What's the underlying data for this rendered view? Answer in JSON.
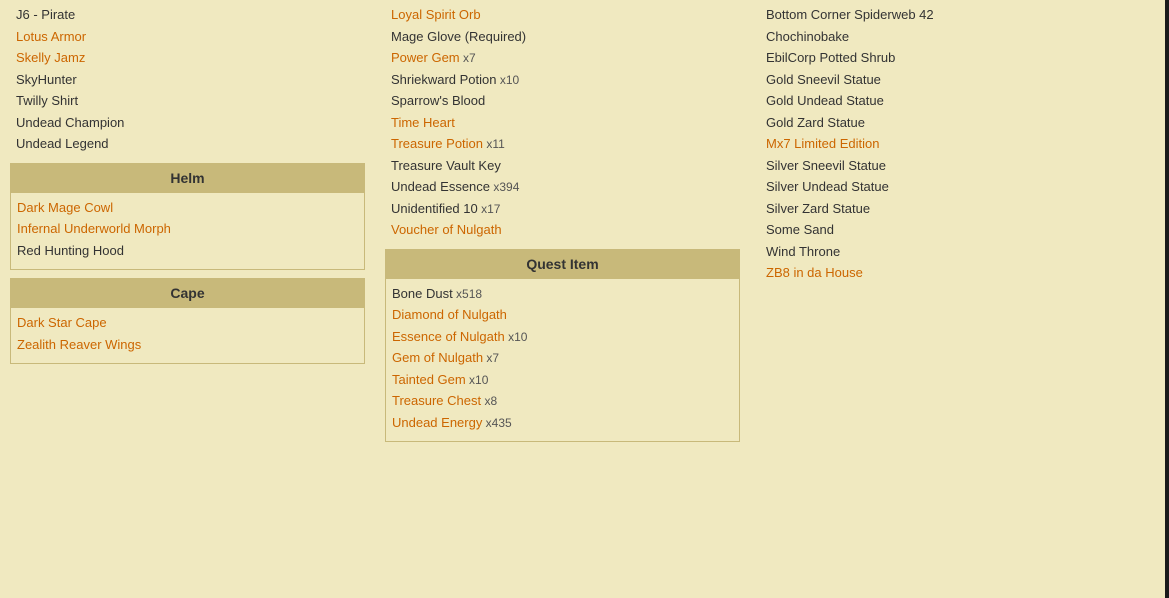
{
  "left": {
    "misc_items": [
      {
        "label": "J6 - Pirate",
        "orange": false
      },
      {
        "label": "Lotus Armor",
        "orange": true
      },
      {
        "label": "Skelly Jamz",
        "orange": true
      },
      {
        "label": "SkyHunter",
        "orange": false
      },
      {
        "label": "Twilly Shirt",
        "orange": false
      },
      {
        "label": "Undead Champion",
        "orange": false
      },
      {
        "label": "Undead Legend",
        "orange": false
      }
    ],
    "helm_header": "Helm",
    "helm_items": [
      {
        "label": "Dark Mage Cowl",
        "orange": true
      },
      {
        "label": "Infernal Underworld Morph",
        "orange": true
      },
      {
        "label": "Red Hunting Hood",
        "orange": false
      }
    ],
    "cape_header": "Cape",
    "cape_items": [
      {
        "label": "Dark Star Cape",
        "orange": true
      },
      {
        "label": "Zealith Reaver Wings",
        "orange": true
      }
    ]
  },
  "middle": {
    "items": [
      {
        "label": "Loyal Spirit Orb",
        "orange": true,
        "count": ""
      },
      {
        "label": "Mage Glove (Required)",
        "orange": false,
        "count": ""
      },
      {
        "label": "Power Gem",
        "orange": true,
        "count": "x7"
      },
      {
        "label": "Shriekward Potion",
        "orange": false,
        "count": "x10"
      },
      {
        "label": "Sparrow's Blood",
        "orange": false,
        "count": ""
      },
      {
        "label": "Time Heart",
        "orange": true,
        "count": ""
      },
      {
        "label": "Treasure Potion",
        "orange": true,
        "count": "x11"
      },
      {
        "label": "Treasure Vault Key",
        "orange": false,
        "count": ""
      },
      {
        "label": "Undead Essence",
        "orange": false,
        "count": "x394"
      },
      {
        "label": "Unidentified 10",
        "orange": false,
        "count": "x17"
      },
      {
        "label": "Voucher of Nulgath",
        "orange": true,
        "count": ""
      }
    ],
    "quest_header": "Quest Item",
    "quest_items": [
      {
        "label": "Bone Dust",
        "orange": false,
        "count": "x518"
      },
      {
        "label": "Diamond of Nulgath",
        "orange": true,
        "count": ""
      },
      {
        "label": "Essence of Nulgath",
        "orange": true,
        "count": "x10"
      },
      {
        "label": "Gem of Nulgath",
        "orange": true,
        "count": "x7"
      },
      {
        "label": "Tainted Gem",
        "orange": true,
        "count": "x10"
      },
      {
        "label": "Treasure Chest",
        "orange": true,
        "count": "x8"
      },
      {
        "label": "Undead Energy",
        "orange": true,
        "count": "x435"
      }
    ]
  },
  "right": {
    "items": [
      {
        "label": "Bottom Corner Spiderweb 42",
        "orange": false
      },
      {
        "label": "Chochinobake",
        "orange": false
      },
      {
        "label": "EbilCorp Potted Shrub",
        "orange": false
      },
      {
        "label": "Gold Sneevil Statue",
        "orange": false
      },
      {
        "label": "Gold Undead Statue",
        "orange": false
      },
      {
        "label": "Gold Zard Statue",
        "orange": false
      },
      {
        "label": "Mx7 Limited Edition",
        "orange": true
      },
      {
        "label": "Silver Sneevil Statue",
        "orange": false
      },
      {
        "label": "Silver Undead Statue",
        "orange": false
      },
      {
        "label": "Silver Zard Statue",
        "orange": false
      },
      {
        "label": "Some Sand",
        "orange": false
      },
      {
        "label": "Wind Throne",
        "orange": false
      },
      {
        "label": "ZB8 in da House",
        "orange": true
      }
    ]
  }
}
